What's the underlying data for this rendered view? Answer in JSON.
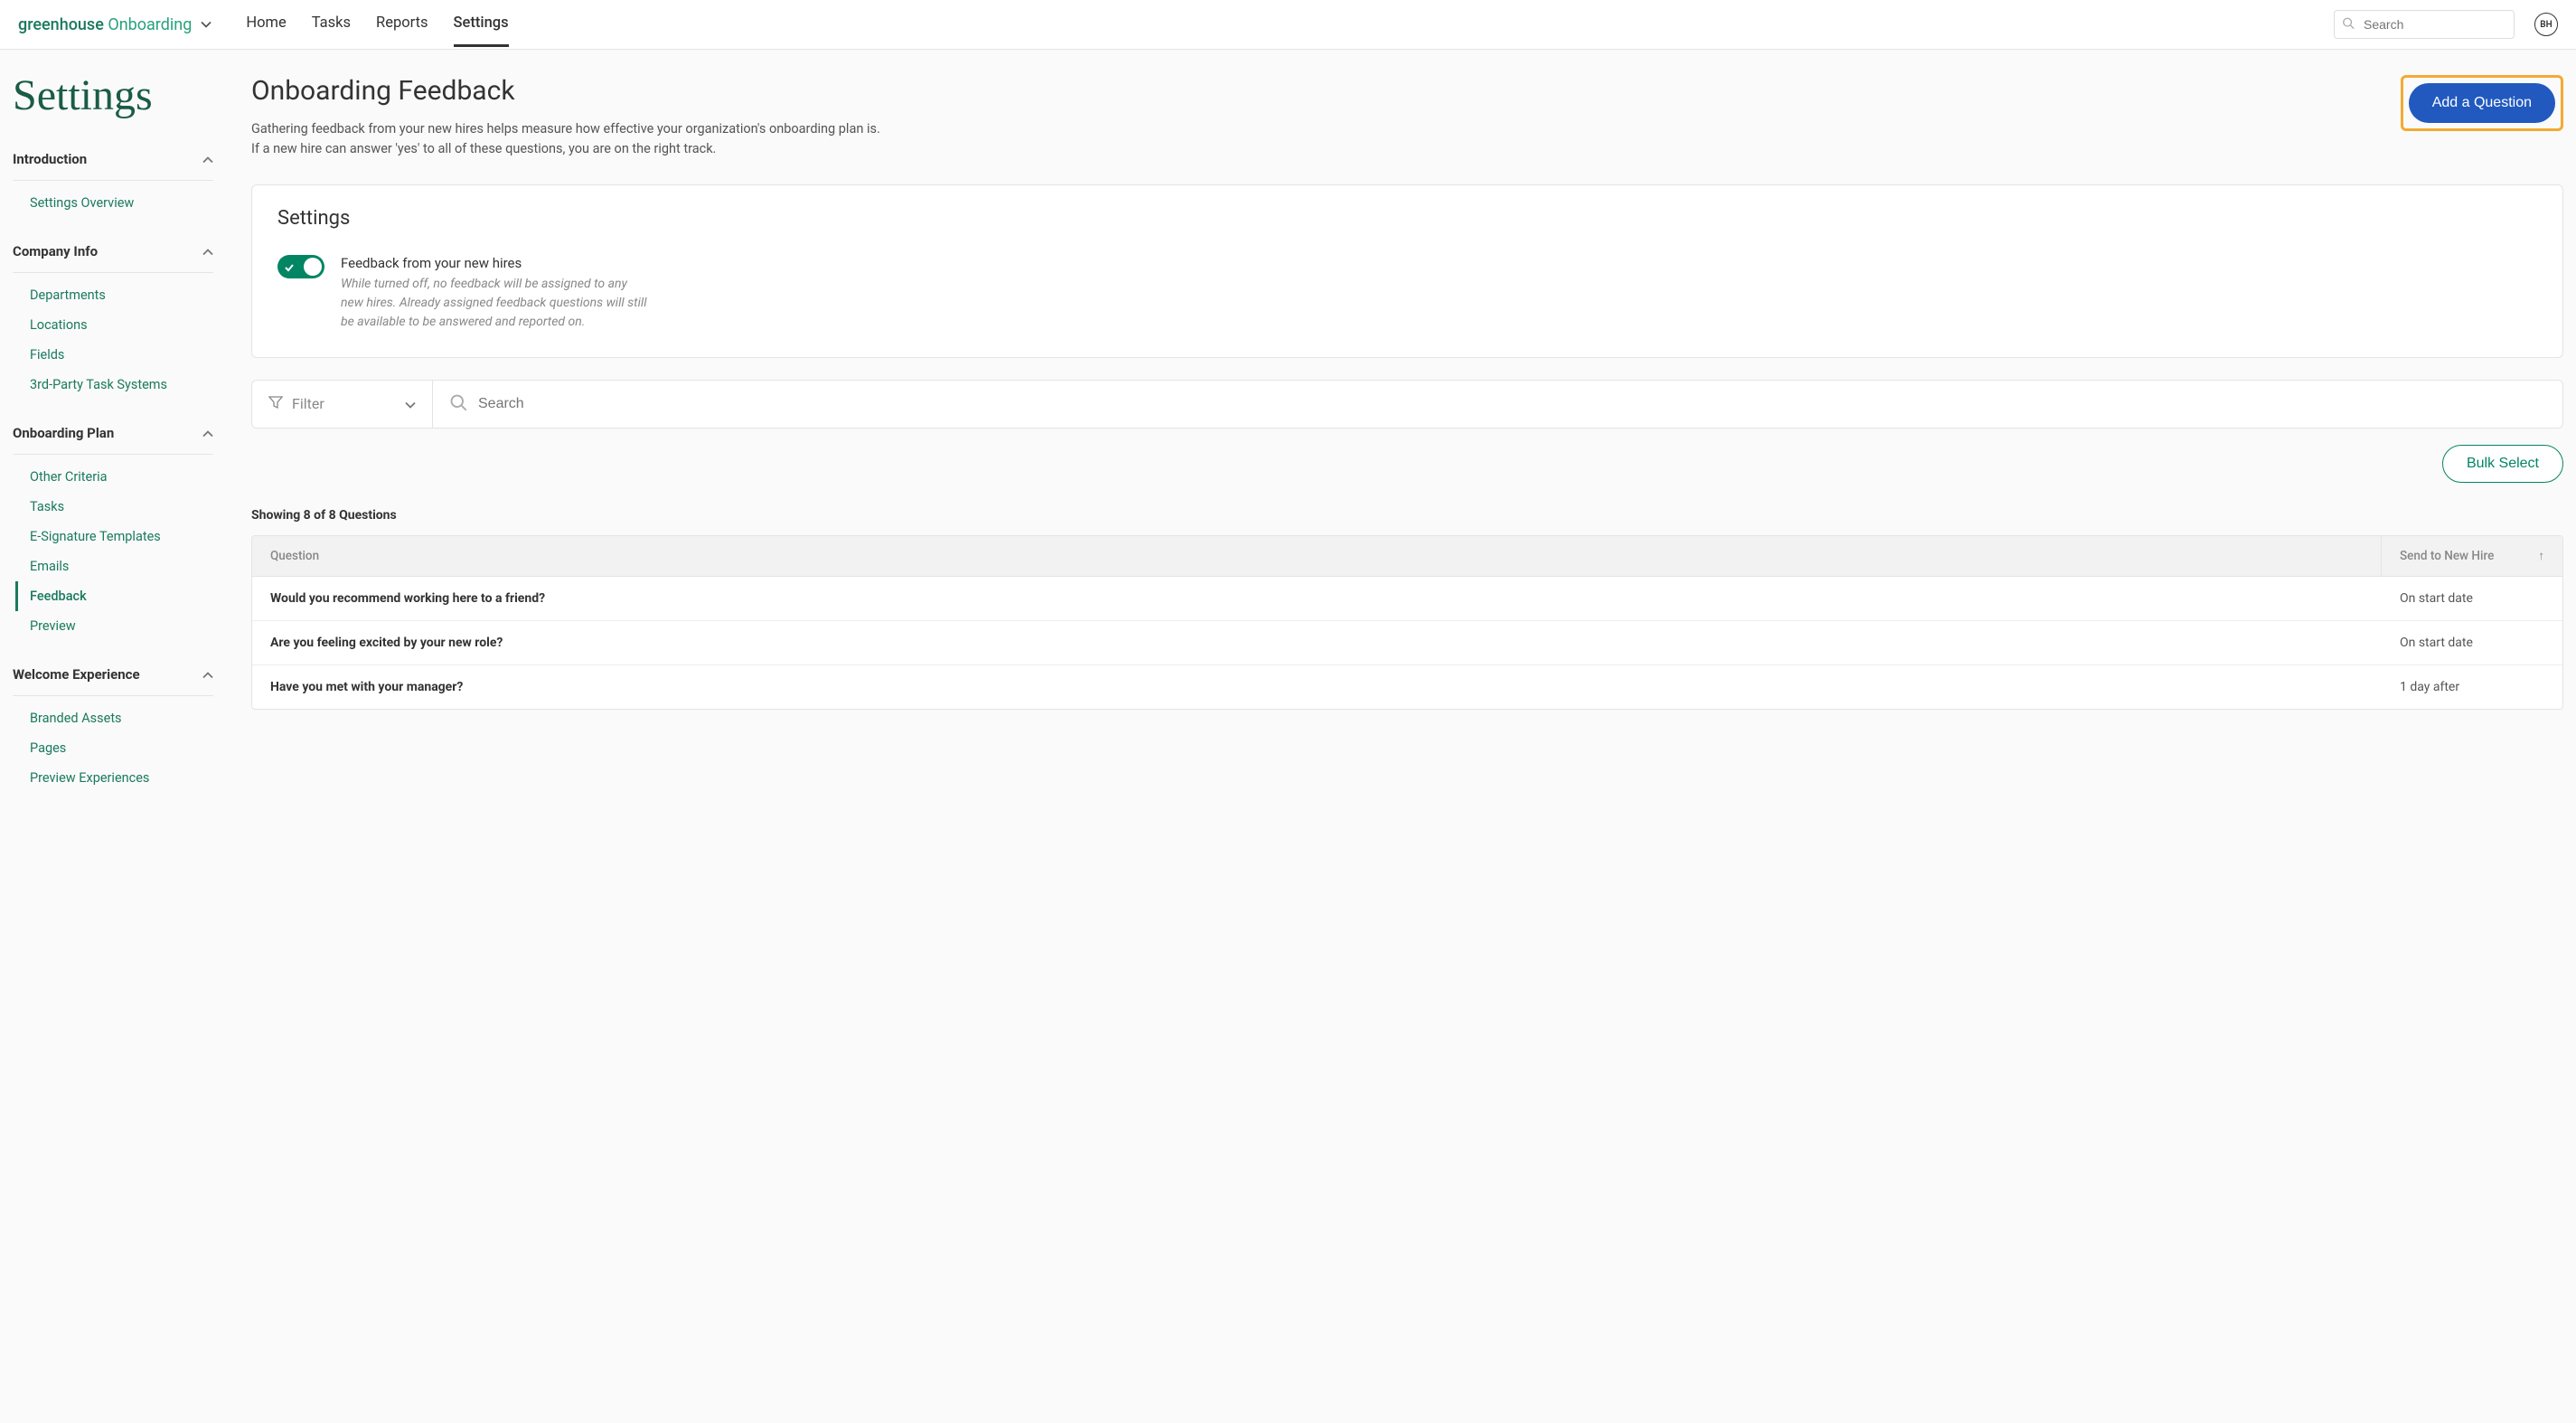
{
  "logo": {
    "part1": "greenhouse",
    "part2": "Onboarding"
  },
  "nav": {
    "links": [
      "Home",
      "Tasks",
      "Reports",
      "Settings"
    ],
    "active": "Settings",
    "search_placeholder": "Search",
    "avatar_initials": "BH"
  },
  "page_title": "Settings",
  "sidebar": {
    "sections": [
      {
        "label": "Introduction",
        "items": [
          "Settings Overview"
        ]
      },
      {
        "label": "Company Info",
        "items": [
          "Departments",
          "Locations",
          "Fields",
          "3rd-Party Task Systems"
        ]
      },
      {
        "label": "Onboarding Plan",
        "items": [
          "Other Criteria",
          "Tasks",
          "E-Signature Templates",
          "Emails",
          "Feedback",
          "Preview"
        ],
        "active": "Feedback"
      },
      {
        "label": "Welcome Experience",
        "items": [
          "Branded Assets",
          "Pages",
          "Preview Experiences"
        ]
      }
    ]
  },
  "main": {
    "title": "Onboarding Feedback",
    "desc_line1": "Gathering feedback from your new hires helps measure how effective your organization's onboarding plan is.",
    "desc_line2": "If a new hire can answer 'yes' to all of these questions, you are on the right track.",
    "add_button": "Add a Question"
  },
  "settings_card": {
    "title": "Settings",
    "toggle_label": "Feedback from your new hires",
    "toggle_desc": "While turned off, no feedback will be assigned to any new hires. Already assigned feedback questions will still be available to be answered and reported on."
  },
  "filter": {
    "label": "Filter",
    "search_placeholder": "Search"
  },
  "bulk_select_label": "Bulk Select",
  "showing_text": "Showing 8 of 8 Questions",
  "table": {
    "headers": {
      "question": "Question",
      "send": "Send to New Hire"
    },
    "rows": [
      {
        "question": "Would you recommend working here to a friend?",
        "send": "On start date"
      },
      {
        "question": "Are you feeling excited by your new role?",
        "send": "On start date"
      },
      {
        "question": "Have you met with your manager?",
        "send": "1 day after"
      }
    ]
  }
}
